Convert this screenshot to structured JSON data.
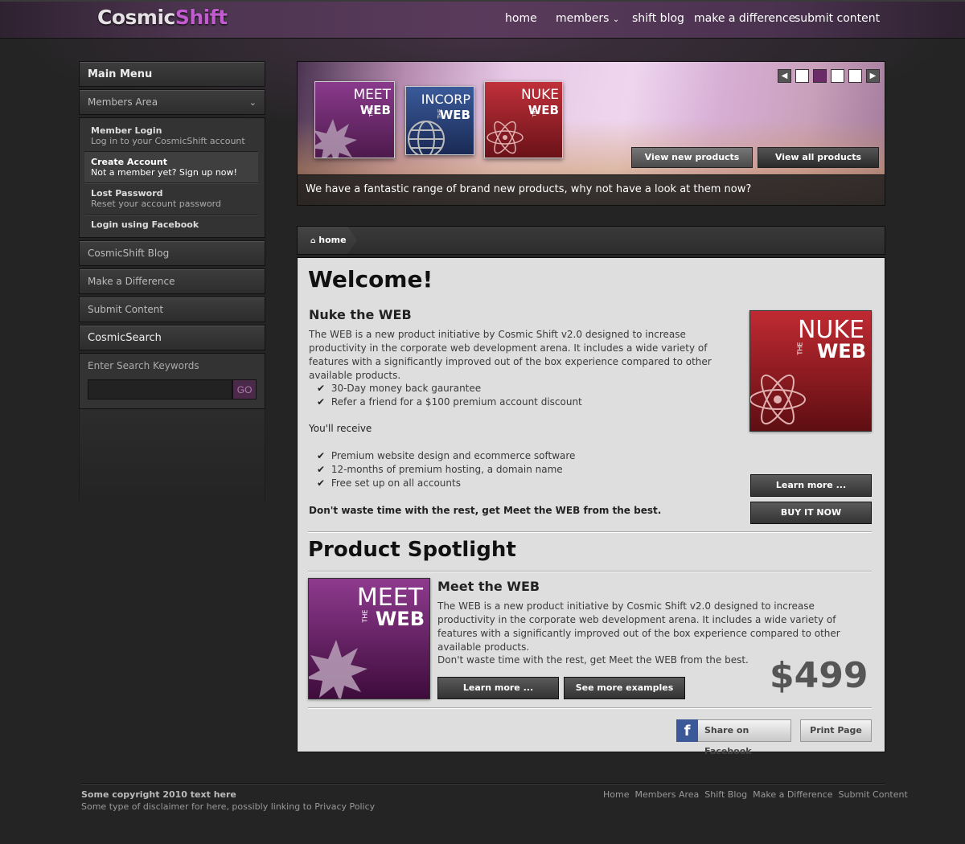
{
  "logo": {
    "part1": "Cosmic",
    "part2": "Shift"
  },
  "nav": [
    "home",
    "members",
    "shift blog",
    "make a difference",
    "submit content"
  ],
  "sidebar": {
    "main_menu": "Main Menu",
    "members_area": "Members Area",
    "sub": [
      {
        "title": "Member Login",
        "desc": "Log in to your CosmicShift account"
      },
      {
        "title": "Create Account",
        "desc": "Not a member yet?  Sign up now!"
      },
      {
        "title": "Lost Password",
        "desc": "Reset your account password"
      },
      {
        "title": "Login using Facebook",
        "desc": ""
      }
    ],
    "items": [
      "CosmicShift Blog",
      "Make a Difference",
      "Submit Content"
    ],
    "search_title": "CosmicSearch",
    "search_label": "Enter Search Keywords",
    "go": "GO"
  },
  "slider": {
    "products": [
      {
        "l1": "MEET",
        "l2": "WEB",
        "the": "THE"
      },
      {
        "l1": "INCORP",
        "l2": "WEB",
        "the": "THE"
      },
      {
        "l1": "NUKE",
        "l2": "WEB",
        "the": "THE"
      }
    ],
    "btn_new": "View new products",
    "btn_all": "View all products",
    "caption": "We have a fantastic range of brand new products, why not have a look at them now?",
    "prev": "◀",
    "next": "▶"
  },
  "breadcrumb": {
    "home": "home"
  },
  "welcome": {
    "title": "Welcome!",
    "product_title": "Nuke the WEB",
    "desc": "The WEB is a new product initiative by Cosmic Shift v2.0 designed to increase productivity in the corporate web development arena.  It includes a wide variety of features with a significantly improved out of the box experience compared to other available products.",
    "checks1": [
      "30-Day money back gaurantee",
      "Refer a friend for a $100 premium account discount"
    ],
    "receive": "You'll receive",
    "checks2": [
      "Premium website design and ecommerce software",
      "12-months of premium hosting, a domain name",
      "Free set up on all accounts"
    ],
    "closing": "Don't waste time with the rest, get Meet the WEB from the best.",
    "box": {
      "l1": "NUKE",
      "l2": "WEB",
      "the": "THE"
    },
    "learn": "Learn more ...",
    "buy": "BUY IT NOW"
  },
  "spotlight": {
    "title": "Product Spotlight",
    "product_title": "Meet the WEB",
    "desc": "The WEB is a new product initiative by Cosmic Shift v2.0 designed to increase productivity in the corporate web development arena.  It includes a wide variety of features with a significantly improved out of the box experience compared to other available products.",
    "closing": "Don't waste time with the rest, get Meet the WEB from the best.",
    "price": "$499",
    "box": {
      "l1": "MEET",
      "l2": "WEB",
      "the": "THE"
    },
    "learn": "Learn more ...",
    "examples": "See more examples",
    "share": "Share on Facebook",
    "print": "Print Page"
  },
  "footer": {
    "copyright": "Some copyright 2010 text here",
    "disclaimer": "Some type of disclaimer for here, possibly linking to Privacy Policy",
    "links": [
      "Home",
      "Members Area",
      "Shift Blog",
      "Make a Difference",
      "Submit Content"
    ]
  },
  "colors": {
    "accent": "#c25ad0",
    "background": "#242424",
    "content_bg": "#dedede"
  }
}
